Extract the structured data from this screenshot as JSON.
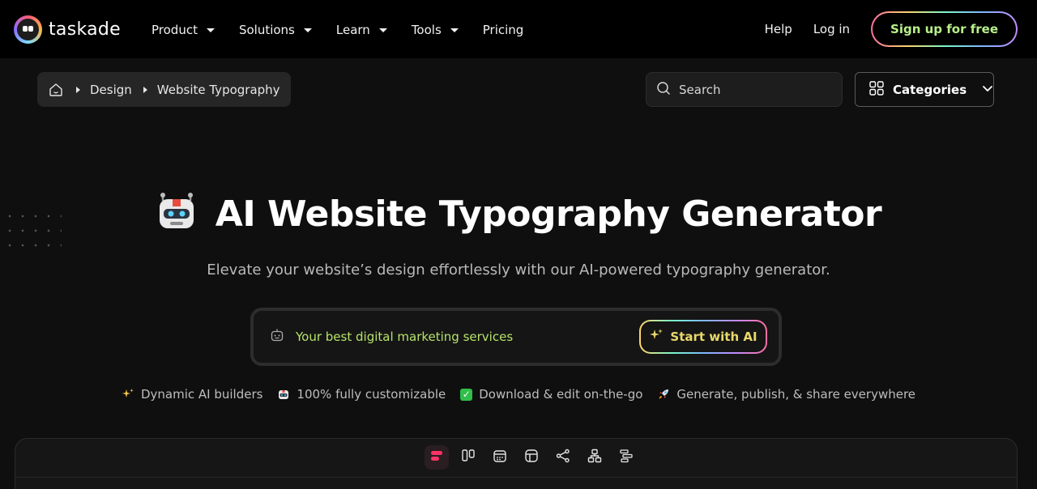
{
  "brand": {
    "name": "taskade"
  },
  "nav": {
    "items": [
      {
        "label": "Product",
        "has_menu": true
      },
      {
        "label": "Solutions",
        "has_menu": true
      },
      {
        "label": "Learn",
        "has_menu": true
      },
      {
        "label": "Tools",
        "has_menu": true
      },
      {
        "label": "Pricing",
        "has_menu": false
      }
    ],
    "help": "Help",
    "login": "Log in",
    "signup": "Sign up for free"
  },
  "breadcrumb": {
    "items": [
      "Design",
      "Website Typography"
    ]
  },
  "search": {
    "placeholder": "Search"
  },
  "categories": {
    "label": "Categories"
  },
  "hero": {
    "title": "AI Website Typography Generator",
    "subtitle": "Elevate your website’s design effortlessly with our AI-powered typography generator."
  },
  "prompt": {
    "text": "Your best digital marketing services",
    "button": "Start with AI"
  },
  "features": [
    {
      "icon": "sparkles-icon",
      "label": "Dynamic AI builders"
    },
    {
      "icon": "robot-icon",
      "label": "100% fully customizable"
    },
    {
      "icon": "check-icon",
      "label": "Download & edit on-the-go"
    },
    {
      "icon": "rocket-icon",
      "label": "Generate, publish, & share everywhere"
    }
  ],
  "view_switcher": {
    "active": "list",
    "views": [
      "list-icon",
      "board-icon",
      "calendar-icon",
      "table-icon",
      "mindmap-icon",
      "orgchart-icon",
      "gantt-icon"
    ]
  },
  "colors": {
    "background": "#0f0f0f",
    "nav_background": "#000000",
    "prompt_text": "#b7e36a",
    "accent_pink": "#ff3366"
  }
}
